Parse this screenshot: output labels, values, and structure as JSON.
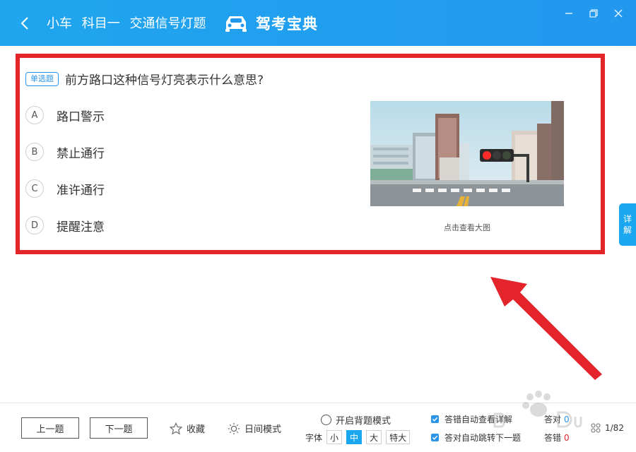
{
  "header": {
    "crumbs": [
      "小车",
      "科目一",
      "交通信号灯题"
    ],
    "brand_name": "驾考宝典",
    "icons": [
      "back-arrow-icon",
      "car-logo-icon",
      "minimize-icon",
      "restore-icon",
      "close-icon"
    ]
  },
  "question": {
    "type_label": "单选题",
    "text": "前方路口这种信号灯亮表示什么意思?",
    "options": [
      {
        "letter": "A",
        "text": "路口警示"
      },
      {
        "letter": "B",
        "text": "禁止通行"
      },
      {
        "letter": "C",
        "text": "准许通行"
      },
      {
        "letter": "D",
        "text": "提醒注意"
      }
    ],
    "image_caption": "点击查看大图"
  },
  "side_tab": {
    "label": "详解"
  },
  "footer": {
    "prev_label": "上一题",
    "next_label": "下一题",
    "favorite_label": "收藏",
    "day_mode_label": "日间模式",
    "memo_mode_label": "开启背题模式",
    "font_label": "字体",
    "font_sizes": [
      "小",
      "中",
      "大",
      "特大"
    ],
    "font_selected": "中",
    "auto_detail_label": "答错自动查看详解",
    "auto_next_label": "答对自动跳转下一题",
    "correct_label": "答对",
    "correct_count": "0",
    "wrong_label": "答错",
    "wrong_count": "0",
    "progress": "1/82"
  },
  "colors": {
    "header_blue": "#1fa6ee",
    "accent_blue": "#1aa7ef",
    "annotation_red": "#e3242b"
  }
}
